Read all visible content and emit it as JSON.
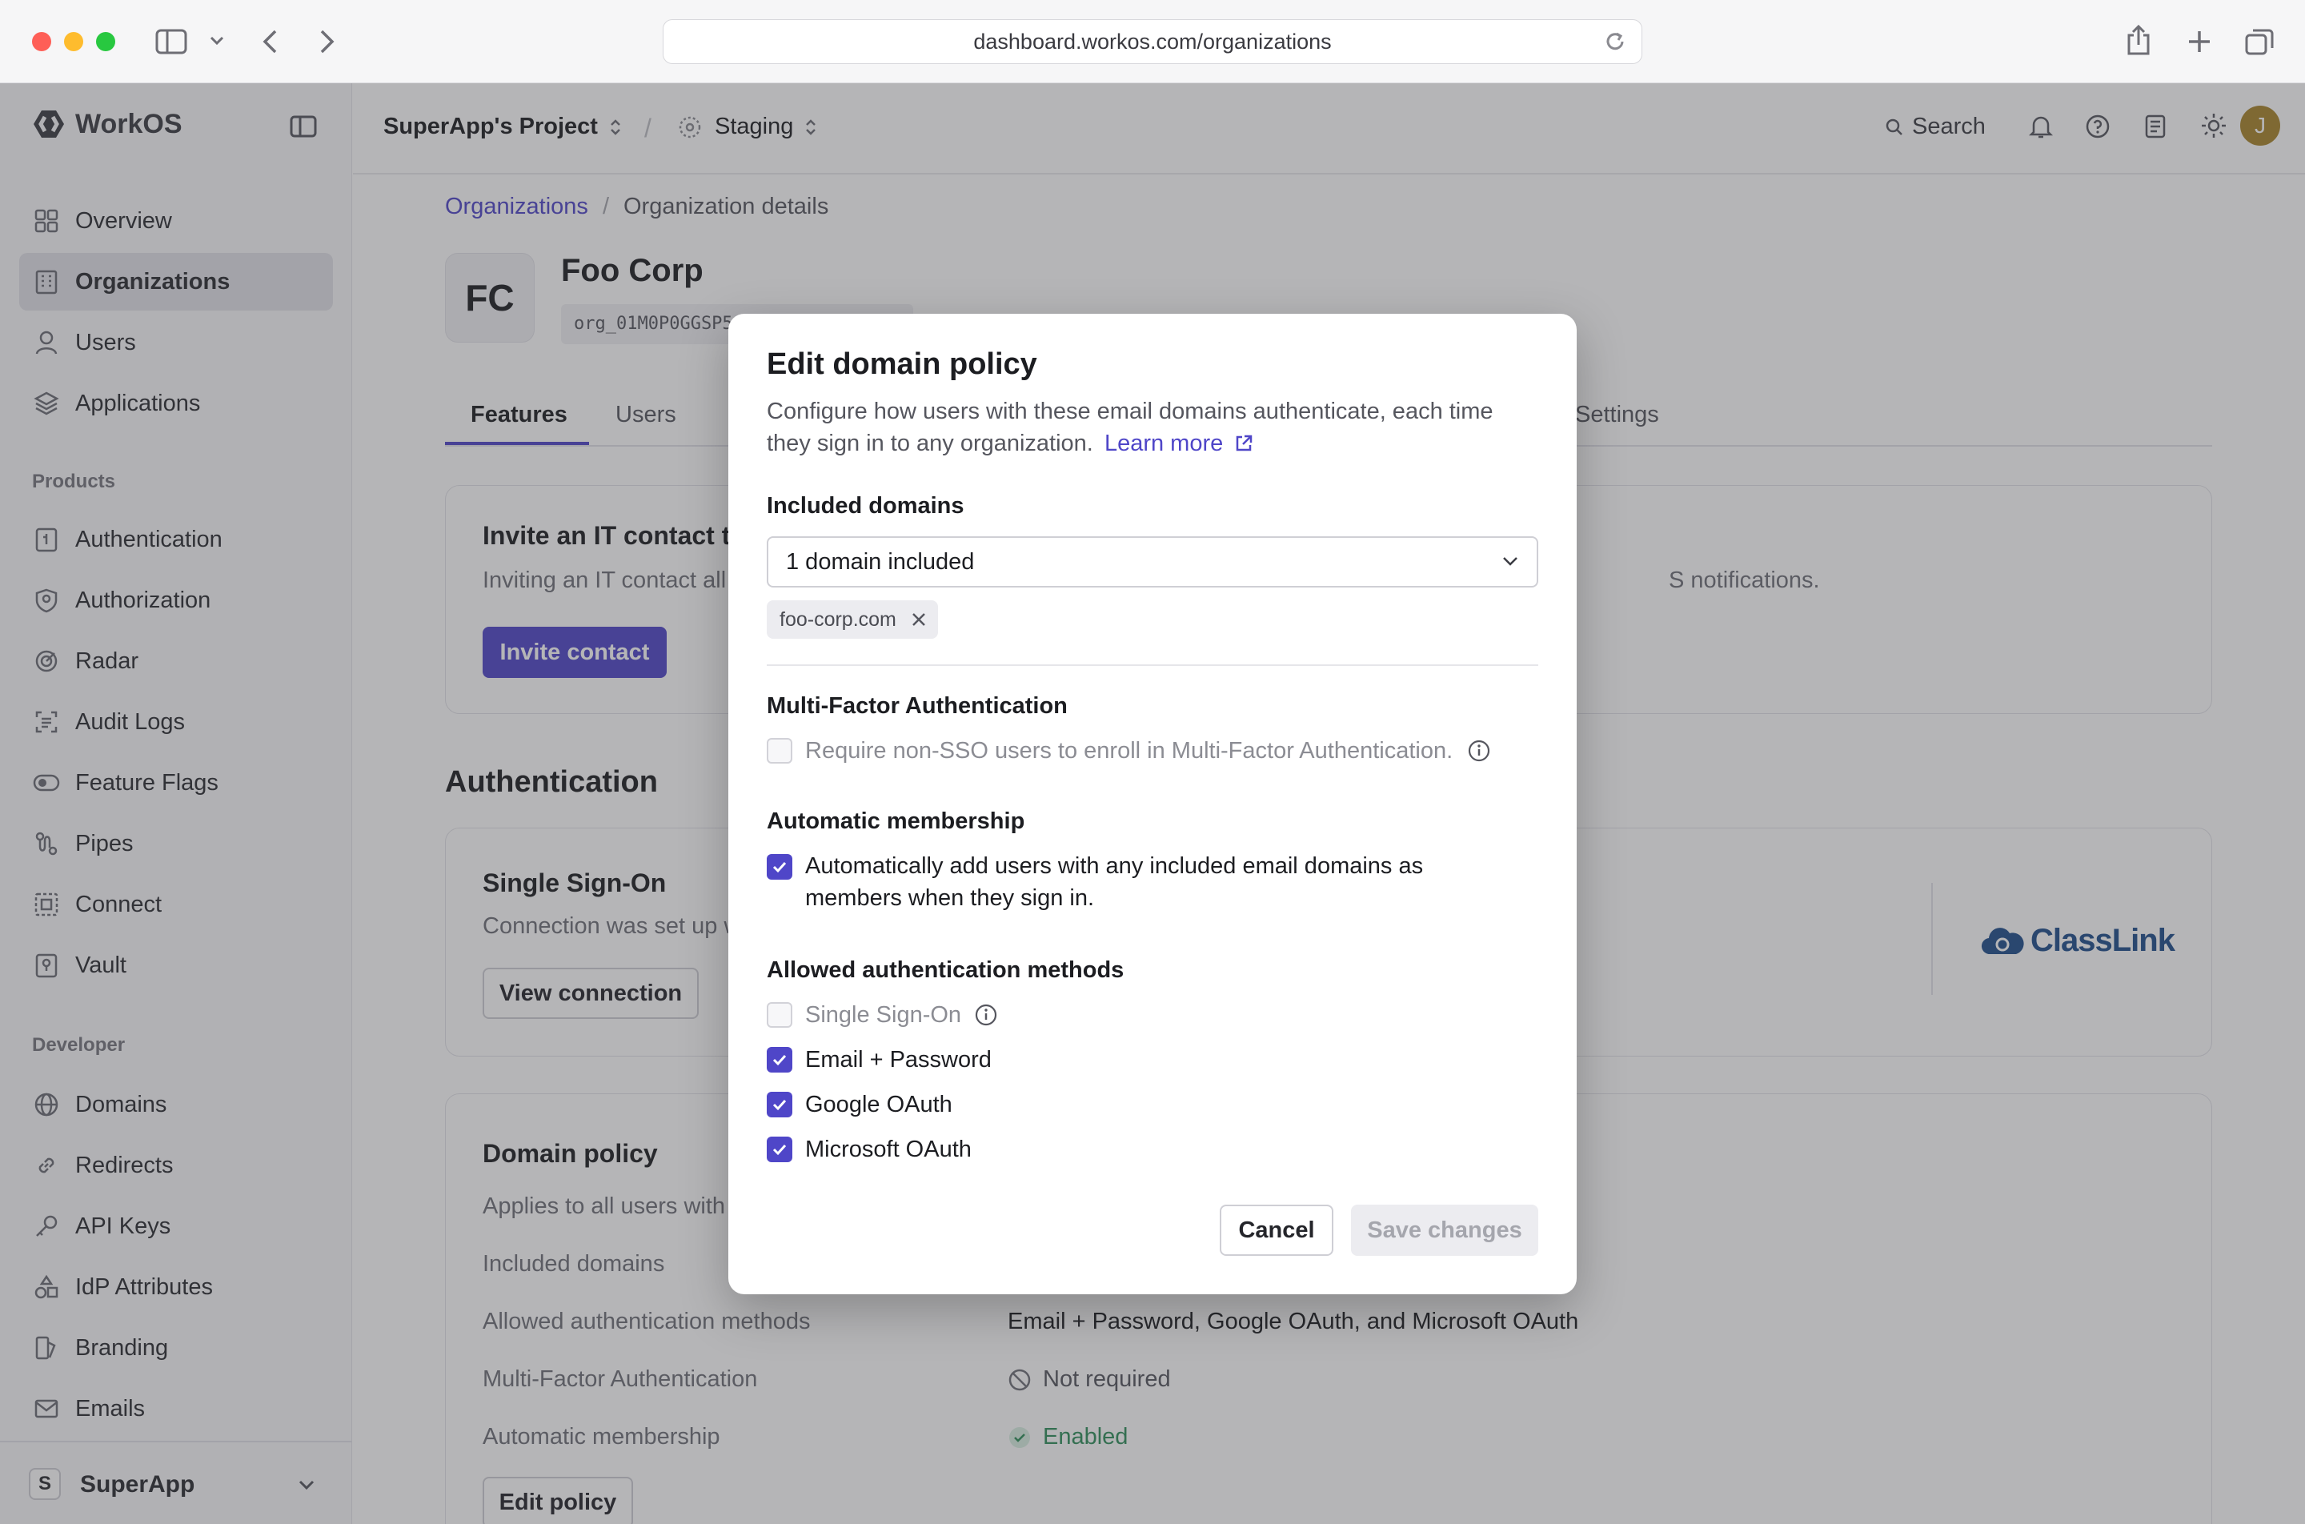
{
  "browser": {
    "url": "dashboard.workos.com/organizations"
  },
  "sidebar": {
    "brand": "WorkOS",
    "items": [
      {
        "label": "Overview",
        "icon": "grid-icon"
      },
      {
        "label": "Organizations",
        "icon": "building-icon",
        "active": true
      },
      {
        "label": "Users",
        "icon": "user-icon"
      },
      {
        "label": "Applications",
        "icon": "layers-icon"
      }
    ],
    "products_label": "Products",
    "products": [
      {
        "label": "Authentication",
        "icon": "key-icon"
      },
      {
        "label": "Authorization",
        "icon": "shield-icon"
      },
      {
        "label": "Radar",
        "icon": "radar-icon"
      },
      {
        "label": "Audit Logs",
        "icon": "audit-icon"
      },
      {
        "label": "Feature Flags",
        "icon": "toggle-icon"
      },
      {
        "label": "Pipes",
        "icon": "pipes-icon"
      },
      {
        "label": "Connect",
        "icon": "connect-icon"
      },
      {
        "label": "Vault",
        "icon": "vault-icon"
      }
    ],
    "developer_label": "Developer",
    "developer": [
      {
        "label": "Domains",
        "icon": "globe-icon"
      },
      {
        "label": "Redirects",
        "icon": "link-icon"
      },
      {
        "label": "API Keys",
        "icon": "api-key-icon"
      },
      {
        "label": "IdP Attributes",
        "icon": "attributes-icon"
      },
      {
        "label": "Branding",
        "icon": "branding-icon"
      },
      {
        "label": "Emails",
        "icon": "mail-icon"
      }
    ],
    "workspace": {
      "initial": "S",
      "name": "SuperApp"
    }
  },
  "topbar": {
    "project": "SuperApp's Project",
    "separator": "/",
    "environment": "Staging",
    "search_label": "Search",
    "avatar_initial": "J"
  },
  "page": {
    "breadcrumb_root": "Organizations",
    "breadcrumb_sep": "/",
    "breadcrumb_current": "Organization details",
    "org_initials": "FC",
    "org_name": "Foo Corp",
    "org_id": "org_01M0P0GGSP5",
    "tabs": [
      "Features",
      "Users",
      "Settings"
    ],
    "invite": {
      "title": "Invite an IT contact t",
      "desc": "Inviting an IT contact all",
      "desc_tail": "S notifications.",
      "button": "Invite contact"
    },
    "auth_heading": "Authentication",
    "sso": {
      "title": "Single Sign-On",
      "desc": "Connection was set up w",
      "button": "View connection",
      "logo": "ClassLink"
    },
    "domain_policy": {
      "title": "Domain policy",
      "desc": "Applies to all users with",
      "rows": [
        {
          "label": "Included domains",
          "value": ""
        },
        {
          "label": "Allowed authentication methods",
          "value": "Email + Password, Google OAuth, and Microsoft OAuth"
        },
        {
          "label": "Multi-Factor Authentication",
          "value": "Not required"
        },
        {
          "label": "Automatic membership",
          "value": "Enabled"
        }
      ],
      "button": "Edit policy"
    }
  },
  "modal": {
    "title": "Edit domain policy",
    "description": "Configure how users with these email domains authenticate, each time they sign in to any organization.",
    "learn_more": "Learn more",
    "included_label": "Included domains",
    "select_value": "1 domain included",
    "chip": "foo-corp.com",
    "mfa_label": "Multi-Factor Authentication",
    "mfa_option": "Require non-SSO users to enroll in Multi-Factor Authentication.",
    "mfa_checked": false,
    "membership_label": "Automatic membership",
    "membership_option": "Automatically add users with any included email domains as members when they sign in.",
    "membership_checked": true,
    "methods_label": "Allowed authentication methods",
    "methods": [
      {
        "label": "Single Sign-On",
        "checked": false,
        "disabled": true
      },
      {
        "label": "Email + Password",
        "checked": true
      },
      {
        "label": "Google OAuth",
        "checked": true
      },
      {
        "label": "Microsoft OAuth",
        "checked": true
      }
    ],
    "cancel": "Cancel",
    "save": "Save changes"
  },
  "colors": {
    "accent": "#4f46c8",
    "success": "#2f8f5b"
  }
}
